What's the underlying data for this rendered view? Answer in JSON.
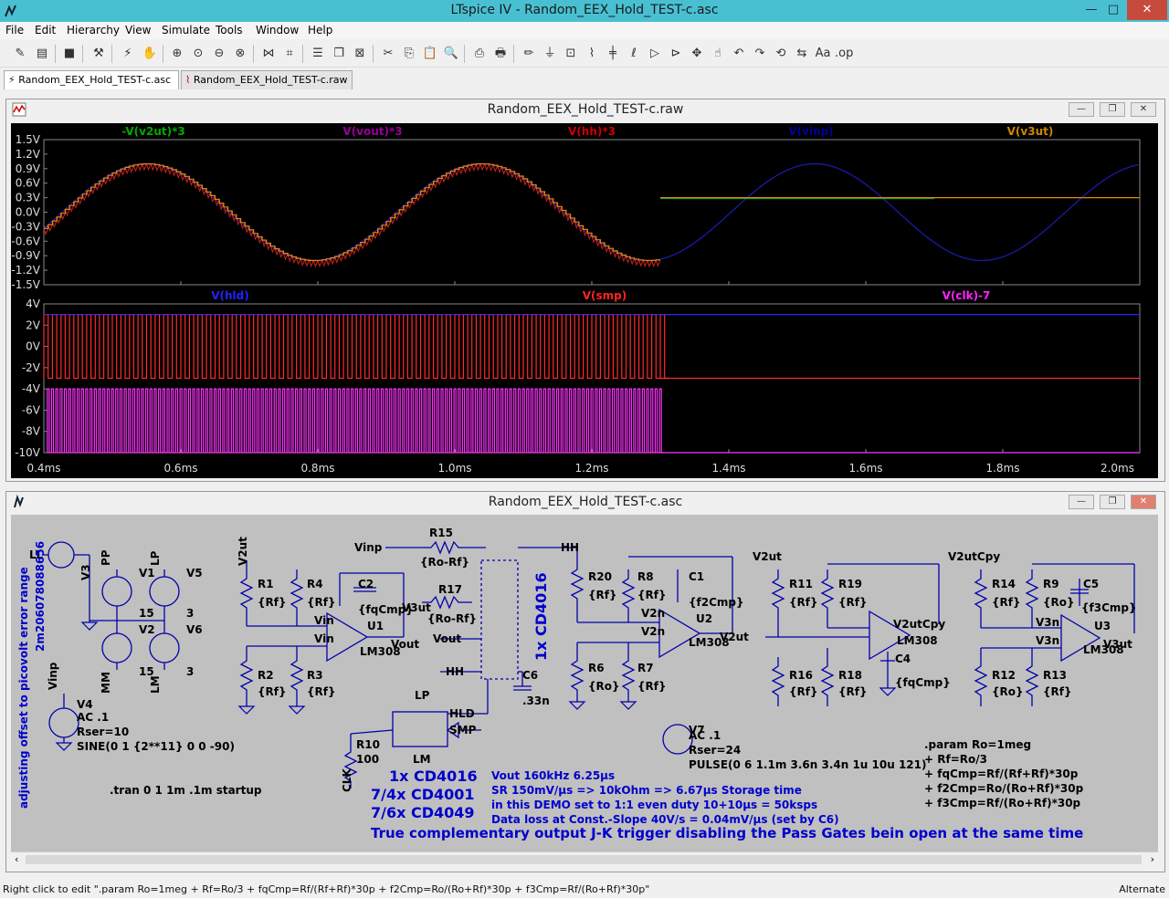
{
  "window": {
    "title": "LTspice IV - Random_EEX_Hold_TEST-c.asc",
    "min_label": "—",
    "max_label": "□",
    "close_label": "✕"
  },
  "menu": [
    "File",
    "Edit",
    "Hierarchy",
    "View",
    "Simulate",
    "Tools",
    "Window",
    "Help"
  ],
  "toolbar_icons": [
    "new-schematic-icon",
    "open-icon",
    "save-icon",
    "control-panel-icon",
    "run-icon",
    "halt-icon",
    "zoom-in-icon",
    "pan-icon",
    "zoom-out-icon",
    "zoom-fit-icon",
    "autorange-icon",
    "tile-horizontal-icon",
    "cascade-icon",
    "close-all-icon",
    "cut-icon",
    "copy-icon",
    "paste-icon",
    "find-icon",
    "print-setup-icon",
    "print-icon",
    "wire-icon",
    "ground-icon",
    "label-icon",
    "resistor-icon",
    "capacitor-icon",
    "inductor-icon",
    "diode-icon",
    "component-icon",
    "rotate-icon",
    "mirror-icon",
    "drag-icon",
    "move-icon",
    "undo-icon",
    "redo-icon",
    "text-icon",
    "spice-directive-icon"
  ],
  "tabs": [
    {
      "label": "Random_EEX_Hold_TEST-c.asc",
      "icon": "schematic-icon",
      "active": true
    },
    {
      "label": "Random_EEX_Hold_TEST-c.raw",
      "icon": "waveform-icon",
      "active": false
    }
  ],
  "waveform_window": {
    "title": "Random_EEX_Hold_TEST-c.raw"
  },
  "schematic_window": {
    "title": "Random_EEX_Hold_TEST-c.asc"
  },
  "plot": {
    "background": "#000000",
    "x_ticks": [
      "0.4ms",
      "0.6ms",
      "0.8ms",
      "1.0ms",
      "1.2ms",
      "1.4ms",
      "1.6ms",
      "1.8ms",
      "2.0ms"
    ],
    "pane1": {
      "y_ticks": [
        "1.5V",
        "1.2V",
        "0.9V",
        "0.6V",
        "0.3V",
        "0.0V",
        "-0.3V",
        "-0.6V",
        "-0.9V",
        "-1.2V",
        "-1.5V"
      ],
      "traces": [
        {
          "name": "-V(v2ut)*3",
          "color": "#00aa00"
        },
        {
          "name": "V(vout)*3",
          "color": "#990099"
        },
        {
          "name": "V(hh)*3",
          "color": "#cc0000"
        },
        {
          "name": "V(vinp)",
          "color": "#000099"
        },
        {
          "name": "V(v3ut)",
          "color": "#cc8800"
        }
      ]
    },
    "pane2": {
      "y_ticks": [
        "4V",
        "2V",
        "0V",
        "-2V",
        "-4V",
        "-6V",
        "-8V",
        "-10V"
      ],
      "traces": [
        {
          "name": "V(hld)",
          "color": "#2222ff"
        },
        {
          "name": "V(smp)",
          "color": "#ff2222"
        },
        {
          "name": "V(clk)-7",
          "color": "#ff22ff"
        }
      ]
    }
  },
  "chart_data": [
    {
      "type": "line",
      "title": "",
      "xlabel": "",
      "ylabel": "",
      "xlim": [
        0.4,
        2.0
      ],
      "ylim": [
        -1.5,
        1.5
      ],
      "x_ticks": [
        "0.4ms",
        "0.6ms",
        "0.8ms",
        "1.0ms",
        "1.2ms",
        "1.4ms",
        "1.6ms",
        "1.8ms",
        "2.0ms"
      ],
      "series": [
        {
          "name": "V(vinp)",
          "description_values": "sine, amplitude 1.0, period 0.4883ms, zero crossing near 0.915ms rising"
        },
        {
          "name": "V(v3ut)",
          "hold_after_ms": 1.3,
          "hold_value": 0.3
        },
        {
          "name": "-V(v2ut)*3",
          "hold_after_ms": 1.3,
          "hold_value": 0.3
        },
        {
          "name": "V(vout)*3"
        },
        {
          "name": "V(hh)*3"
        }
      ]
    },
    {
      "type": "line",
      "title": "",
      "xlim": [
        0.4,
        2.0
      ],
      "ylim": [
        -10,
        4
      ],
      "series": [
        {
          "name": "V(hld)",
          "high": 3,
          "low": -3,
          "stops_toggling_ms": 1.3,
          "final": 3
        },
        {
          "name": "V(smp)",
          "high": 3,
          "low": -3,
          "stops_toggling_ms": 1.3,
          "final": -3
        },
        {
          "name": "V(clk)-7",
          "high": -4,
          "low": -10,
          "period_us": 6.25,
          "stops_ms": 1.3,
          "final": -10
        }
      ]
    }
  ],
  "schematic": {
    "params": [
      ".param Ro=1meg",
      "+ Rf=Ro/3",
      "+ fqCmp=Rf/(Rf+Rf)*30p",
      "+ f2Cmp=Ro/(Ro+Rf)*30p",
      "+ f3Cmp=Rf/(Ro+Rf)*30p"
    ],
    "tran": ".tran 0 1 1m .1m startup",
    "v4": {
      "name": "V4",
      "ac": "AC .1",
      "rser": "Rser=10",
      "sine": "SINE(0 1 {2**11} 0 0 -90)"
    },
    "v7": {
      "name": "V7",
      "ac": "AC .1",
      "rser": "Rser=24",
      "pulse": "PULSE(0 6 1.1m 3.6n 3.4n 1u 10u 121)"
    },
    "notes": [
      "Vout 160kHz 6.25µs",
      "SR 150mV/µs => 10kOhm => 6.67µs Storage time",
      "in this DEMO set to 1:1 even duty 10+10µs = 50ksps",
      "Data loss at Const.-Slope 40V/s = 0.04mV/µs (set by C6)"
    ],
    "footer": "True complementary output J-K trigger disabling the Pass Gates bein open at the same time",
    "big_labels": [
      "1x CD4016",
      "7/4x CD4001",
      "7/6x CD4049",
      "1x CD4016"
    ],
    "vertical_note": "adjusting offset to picovolt error range",
    "vertical_value": "2m206078088656"
  },
  "status": {
    "left": "Right click to edit \".param Ro=1meg  + Rf=Ro/3  + fqCmp=Rf/(Rf+Rf)*30p  + f2Cmp=Ro/(Ro+Rf)*30p  + f3Cmp=Rf/(Ro+Rf)*30p\"",
    "right": "Alternate"
  }
}
